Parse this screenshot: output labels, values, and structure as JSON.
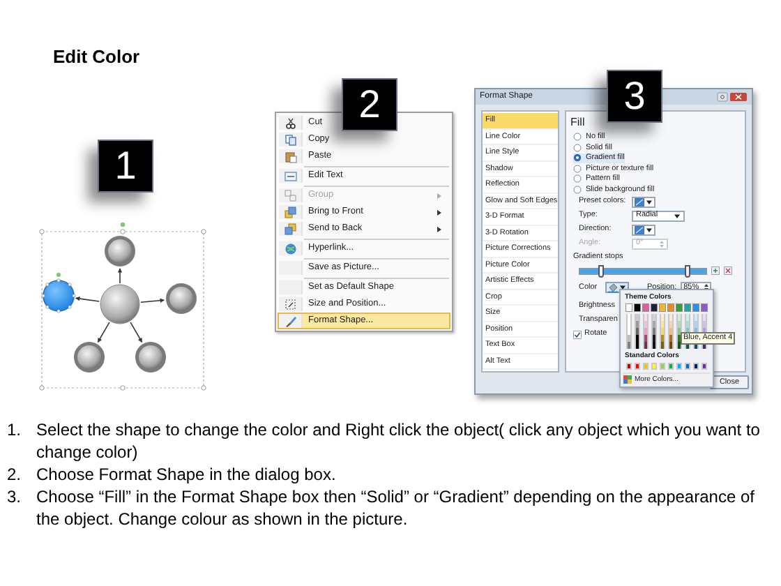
{
  "title": "Edit Color",
  "diagram": {
    "badge": "1",
    "outer_nodes": [
      {
        "selected": false
      },
      {
        "selected": false
      },
      {
        "selected": false
      },
      {
        "selected": false
      },
      {
        "selected": true
      }
    ]
  },
  "context_menu": {
    "badge": "2",
    "items": [
      {
        "label": "Cut",
        "disabled": false,
        "highlighted": false,
        "submenu": false,
        "separator_after": false
      },
      {
        "label": "Copy",
        "disabled": false,
        "highlighted": false,
        "submenu": false,
        "separator_after": false
      },
      {
        "label": "Paste",
        "disabled": false,
        "highlighted": false,
        "submenu": false,
        "separator_after": true
      },
      {
        "label": "Edit Text",
        "disabled": false,
        "highlighted": false,
        "submenu": false,
        "separator_after": true
      },
      {
        "label": "Group",
        "disabled": true,
        "highlighted": false,
        "submenu": true,
        "separator_after": false
      },
      {
        "label": "Bring to Front",
        "disabled": false,
        "highlighted": false,
        "submenu": true,
        "separator_after": false
      },
      {
        "label": "Send to Back",
        "disabled": false,
        "highlighted": false,
        "submenu": true,
        "separator_after": true
      },
      {
        "label": "Hyperlink...",
        "disabled": false,
        "highlighted": false,
        "submenu": false,
        "separator_after": true
      },
      {
        "label": "Save as Picture...",
        "disabled": false,
        "highlighted": false,
        "submenu": false,
        "separator_after": true
      },
      {
        "label": "Set as Default Shape",
        "disabled": false,
        "highlighted": false,
        "submenu": false,
        "separator_after": false
      },
      {
        "label": "Size and Position...",
        "disabled": false,
        "highlighted": false,
        "submenu": false,
        "separator_after": false
      },
      {
        "label": "Format Shape...",
        "disabled": false,
        "highlighted": true,
        "submenu": false,
        "separator_after": false
      }
    ]
  },
  "format_shape": {
    "badge": "3",
    "title": "Format Shape",
    "categories": [
      {
        "label": "Fill",
        "selected": true
      },
      {
        "label": "Line Color",
        "selected": false
      },
      {
        "label": "Line Style",
        "selected": false
      },
      {
        "label": "Shadow",
        "selected": false
      },
      {
        "label": "Reflection",
        "selected": false
      },
      {
        "label": "Glow and Soft Edges",
        "selected": false
      },
      {
        "label": "3-D Format",
        "selected": false
      },
      {
        "label": "3-D Rotation",
        "selected": false
      },
      {
        "label": "Picture Corrections",
        "selected": false
      },
      {
        "label": "Picture Color",
        "selected": false
      },
      {
        "label": "Artistic Effects",
        "selected": false
      },
      {
        "label": "Crop",
        "selected": false
      },
      {
        "label": "Size",
        "selected": false
      },
      {
        "label": "Position",
        "selected": false
      },
      {
        "label": "Text Box",
        "selected": false
      },
      {
        "label": "Alt Text",
        "selected": false
      }
    ],
    "heading": "Fill",
    "fill_options": [
      {
        "label": "No fill",
        "selected": false
      },
      {
        "label": "Solid fill",
        "selected": false
      },
      {
        "label": "Gradient fill",
        "selected": true
      },
      {
        "label": "Picture or texture fill",
        "selected": false
      },
      {
        "label": "Pattern fill",
        "selected": false
      },
      {
        "label": "Slide background fill",
        "selected": false
      }
    ],
    "preset_colors_label": "Preset colors:",
    "type_label": "Type:",
    "type_value": "Radial",
    "direction_label": "Direction:",
    "angle_label": "Angle:",
    "angle_value": "0°",
    "angle_disabled": true,
    "gradient_stops_label": "Gradient stops",
    "gradient_stops": [
      {
        "level": 0.17
      },
      {
        "level": 0.85
      }
    ],
    "color_label": "Color",
    "position_label": "Position:",
    "position_value": "85%",
    "brightness_label": "Brightness",
    "transparency_label": "Transparen",
    "rotate_label": "Rotate",
    "rotate_checked": true,
    "close_button": "Close",
    "color_popup": {
      "theme_heading": "Theme Colors",
      "theme_colors": [
        {
          "color": "#ffffff"
        },
        {
          "color": "#000000"
        },
        {
          "color": "#d9619c"
        },
        {
          "color": "#1f1f3a"
        },
        {
          "color": "#f2b632"
        },
        {
          "color": "#e0902a"
        },
        {
          "color": "#3f9a3c"
        },
        {
          "color": "#2aa3a0"
        },
        {
          "color": "#2f8fe0"
        },
        {
          "color": "#8a5cc8"
        }
      ],
      "tooltip": "Blue, Accent 4",
      "standard_heading": "Standard Colors",
      "standard_colors": [
        {
          "color": "#c00000"
        },
        {
          "color": "#ff0000"
        },
        {
          "color": "#ffc000"
        },
        {
          "color": "#ffff00"
        },
        {
          "color": "#92d050"
        },
        {
          "color": "#00b050"
        },
        {
          "color": "#00b0f0"
        },
        {
          "color": "#0070c0"
        },
        {
          "color": "#002060"
        },
        {
          "color": "#7030a0"
        }
      ],
      "more_colors": "More Colors..."
    }
  },
  "instructions": [
    {
      "number": "1.",
      "text": "Select the shape to change the color and Right click the object( click any object which you want to change color)"
    },
    {
      "number": "2.",
      "text": "Choose Format Shape in the dialog box."
    },
    {
      "number": "3.",
      "text": "Choose “Fill” in the Format Shape box then “Solid” or “Gradient” depending on the appearance of the object. Change colour as shown in the picture."
    }
  ]
}
